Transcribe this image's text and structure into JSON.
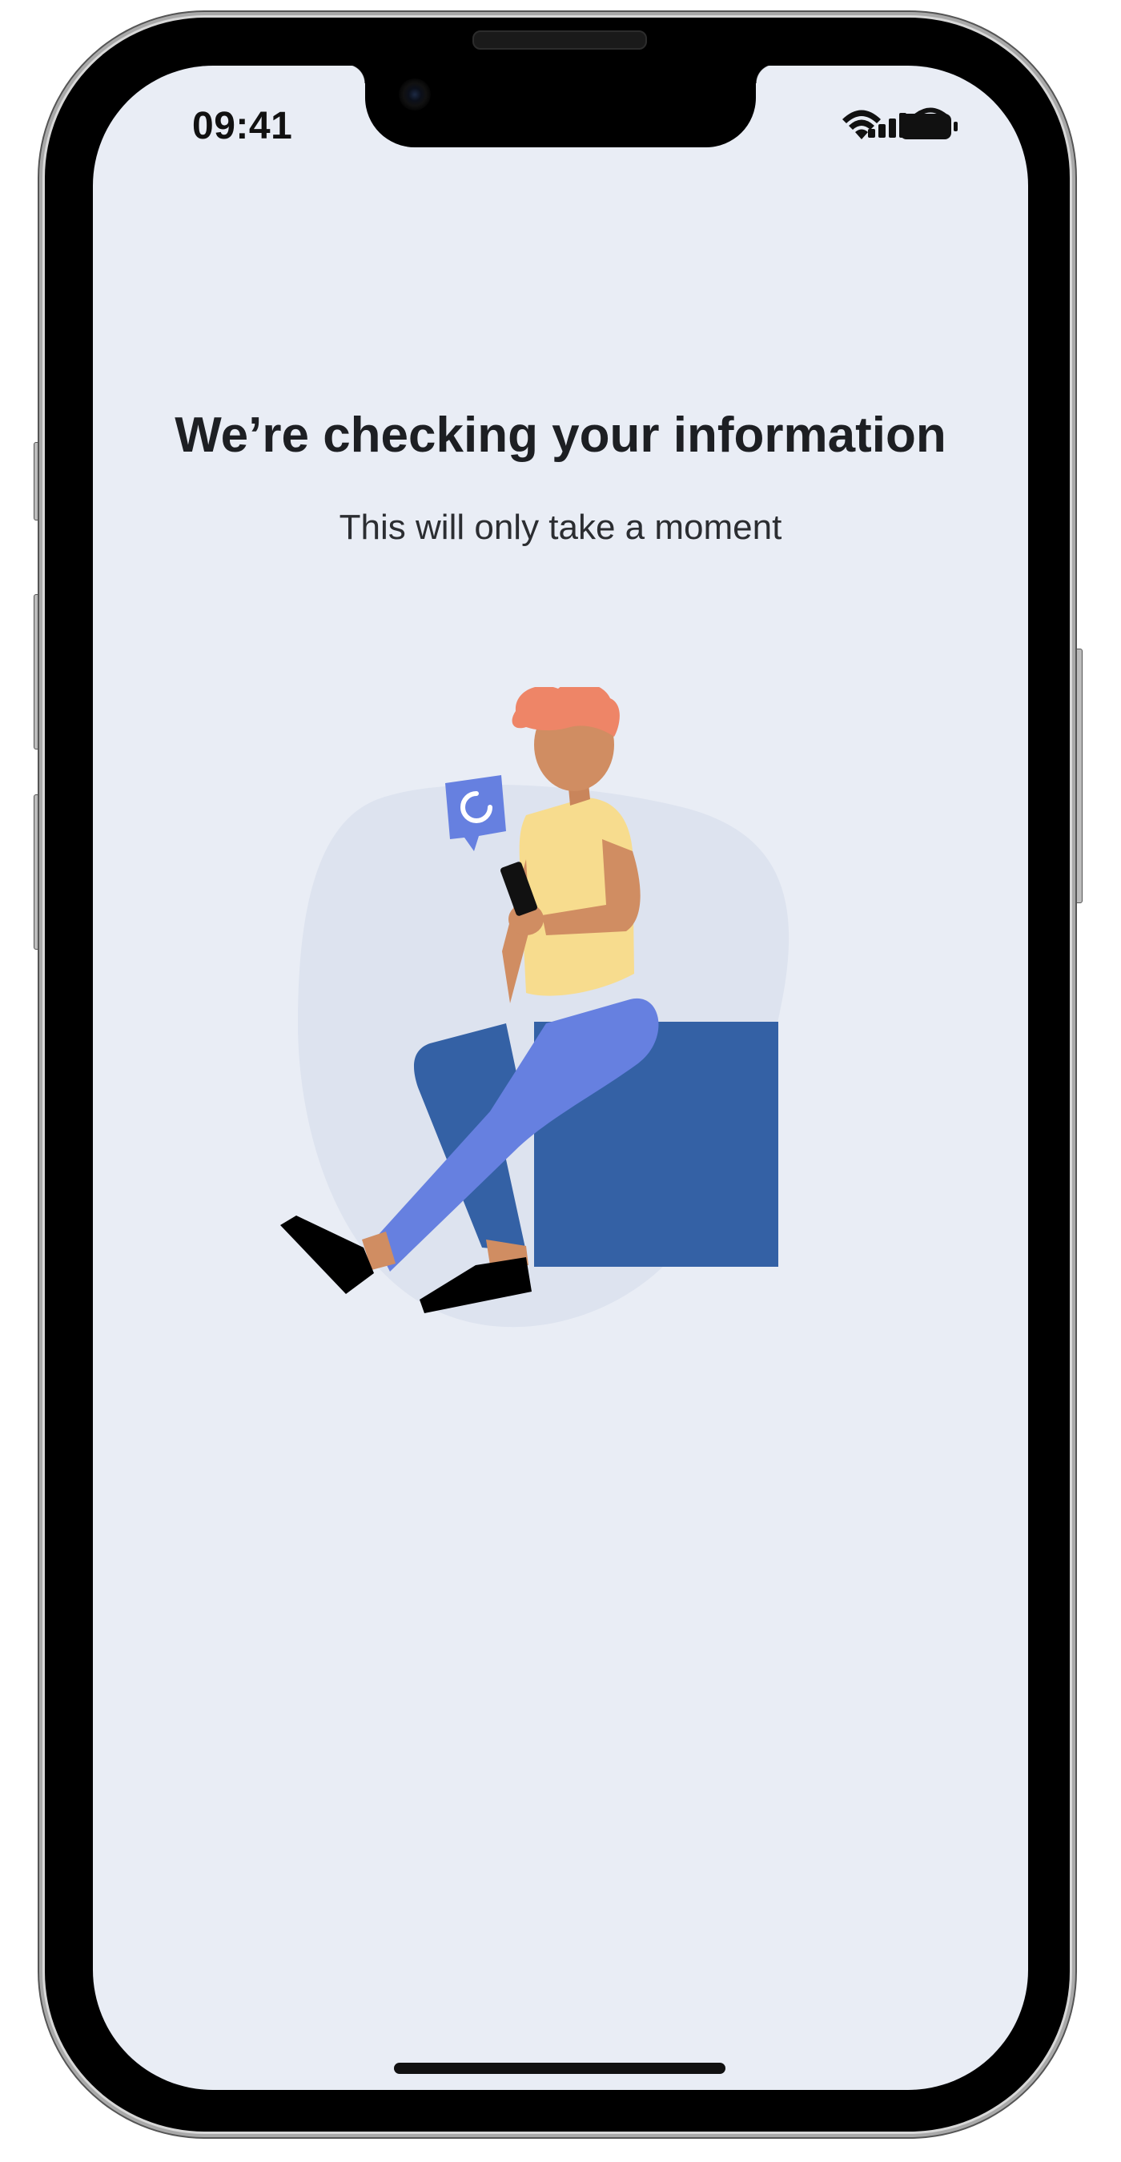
{
  "status_bar": {
    "time": "09:41",
    "icons": [
      "cellular-signal-icon",
      "wifi-icon",
      "battery-icon"
    ]
  },
  "main": {
    "title": "We’re checking your information",
    "subtitle": "This will only take a moment"
  },
  "illustration": {
    "description_icon": "person-on-phone-illustration",
    "badge_icon": "loading-spinner-icon"
  },
  "colors": {
    "screen_background": "#e9edf5",
    "blob": "#dde3ef",
    "box": "#3461a5",
    "pants_front": "#6680e0",
    "pants_back": "#3461a5",
    "shirt": "#f7dc8e",
    "skin": "#d08d62",
    "hair": "#ee8567",
    "badge": "#6680e0",
    "text_primary": "#1d1f23"
  }
}
